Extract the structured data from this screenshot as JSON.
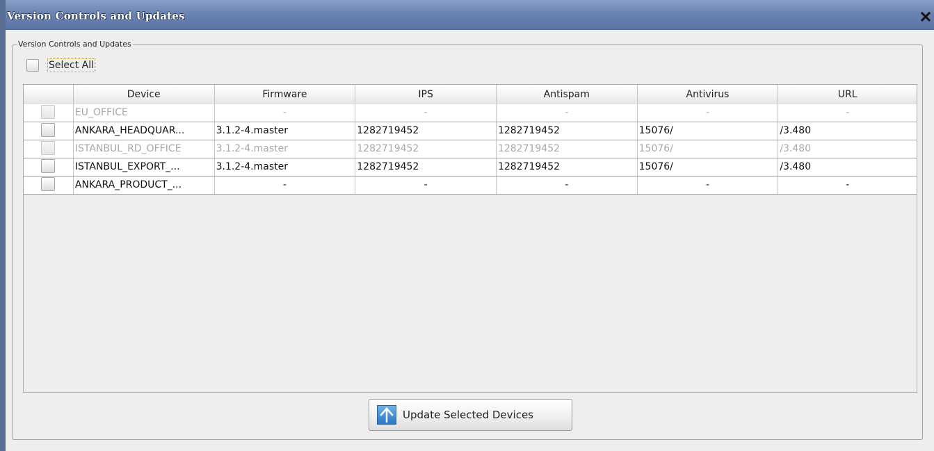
{
  "window": {
    "title": "Version Controls and Updates",
    "close_glyph": "✕"
  },
  "group": {
    "legend": "Version Controls and Updates"
  },
  "select_all": {
    "label": "Select All",
    "checked": false
  },
  "table": {
    "columns": [
      "",
      "Device",
      "Firmware",
      "IPS",
      "Antispam",
      "Antivirus",
      "URL"
    ],
    "rows": [
      {
        "device": "EU_OFFICE",
        "firmware": "-",
        "ips": "-",
        "antispam": "-",
        "antivirus": "-",
        "url": "-",
        "disabled": true,
        "checked": false
      },
      {
        "device": "ANKARA_HEADQUAR...",
        "firmware": "3.1.2-4.master",
        "ips": "1282719452",
        "antispam": "1282719452",
        "antivirus": "15076/",
        "url": "/3.480",
        "disabled": false,
        "checked": false
      },
      {
        "device": "ISTANBUL_RD_OFFICE",
        "firmware": "3.1.2-4.master",
        "ips": "1282719452",
        "antispam": "1282719452",
        "antivirus": "15076/",
        "url": "/3.480",
        "disabled": true,
        "checked": false
      },
      {
        "device": "ISTANBUL_EXPORT_...",
        "firmware": "3.1.2-4.master",
        "ips": "1282719452",
        "antispam": "1282719452",
        "antivirus": "15076/",
        "url": "/3.480",
        "disabled": false,
        "checked": false
      },
      {
        "device": "ANKARA_PRODUCT_...",
        "firmware": "-",
        "ips": "-",
        "antispam": "-",
        "antivirus": "-",
        "url": "-",
        "disabled": false,
        "checked": false
      }
    ]
  },
  "update_button": {
    "label": "Update Selected Devices",
    "icon": "up-arrow-icon"
  },
  "colors": {
    "titlebar": "#6a83b2",
    "disabled_text": "#a8a8a8",
    "icon_blue": "#2a76c4"
  }
}
